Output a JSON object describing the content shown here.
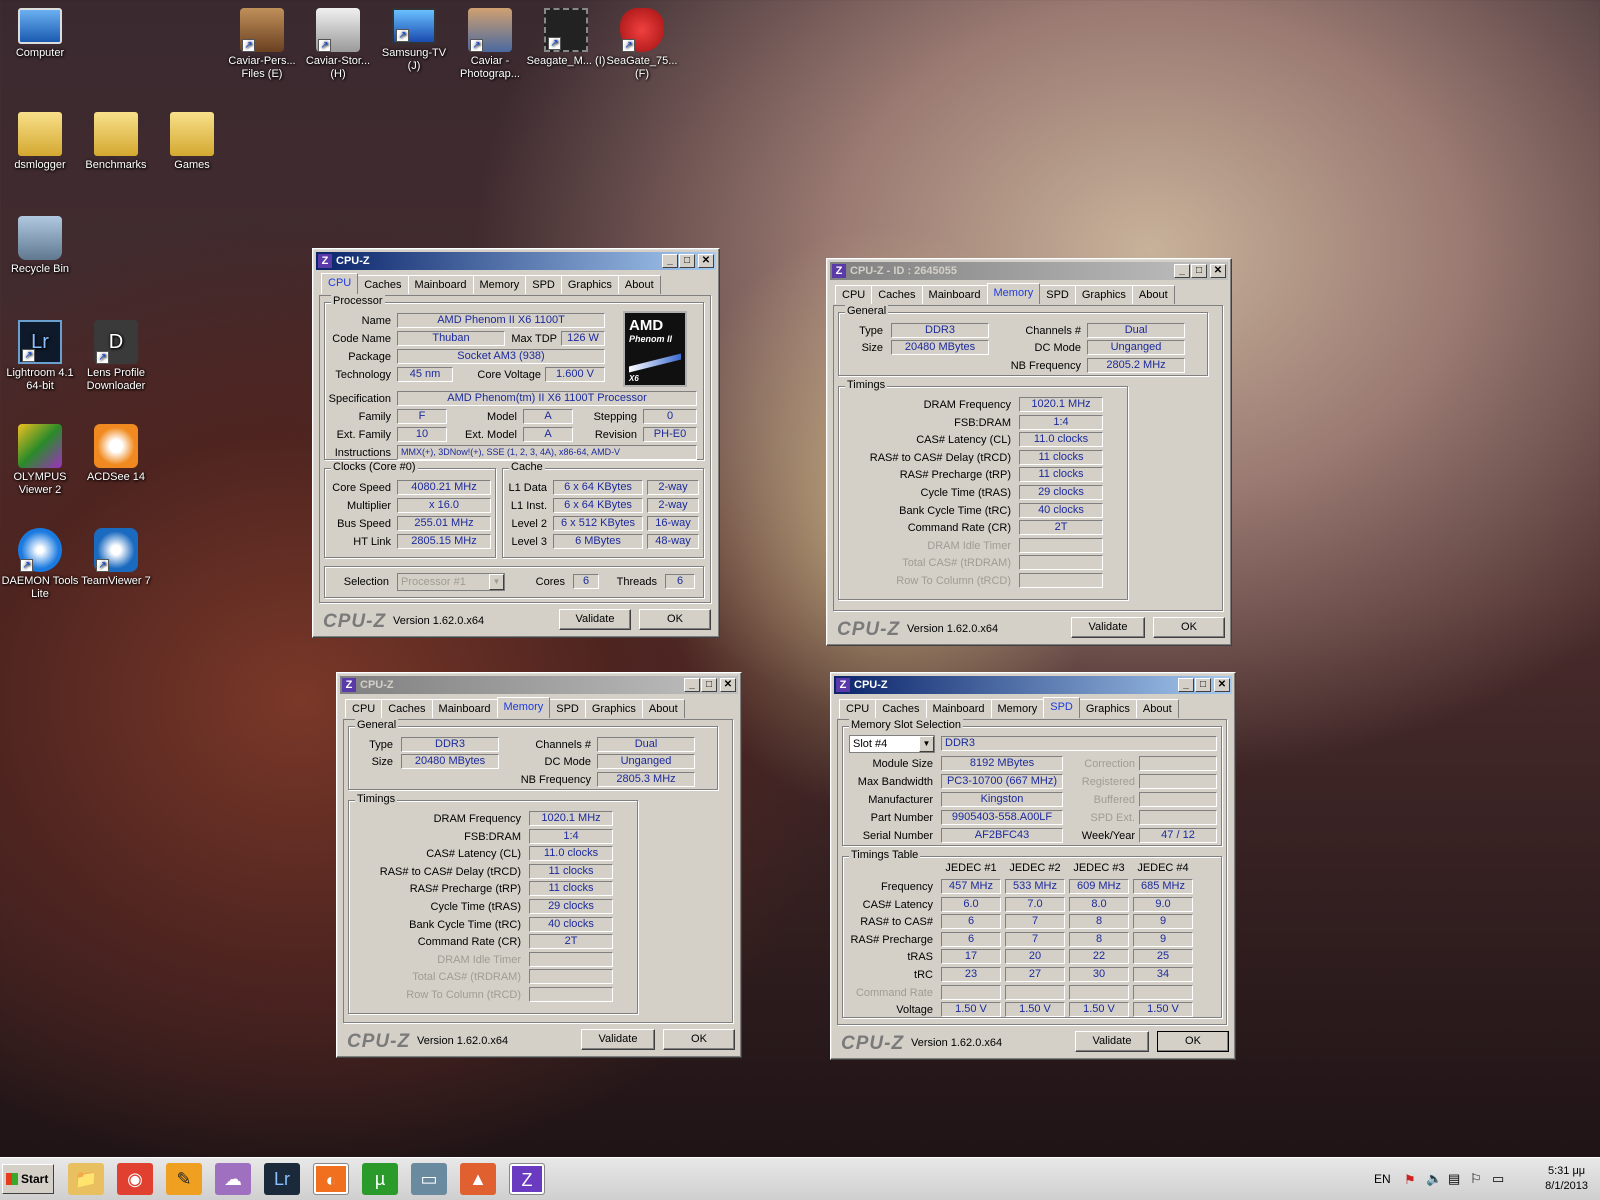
{
  "desktop": {
    "icons": [
      {
        "label": "Computer"
      },
      {
        "label": "Caviar-Pers... Files (E)"
      },
      {
        "label": "Caviar-Stor... (H)"
      },
      {
        "label": "Samsung-TV (J)"
      },
      {
        "label": "Caviar - Photograp..."
      },
      {
        "label": "Seagate_M... (I)"
      },
      {
        "label": "SeaGate_75... (F)"
      },
      {
        "label": "dsmlogger"
      },
      {
        "label": "Benchmarks"
      },
      {
        "label": "Games"
      },
      {
        "label": "Recycle Bin"
      },
      {
        "label": "Lightroom 4.1 64-bit"
      },
      {
        "label": "Lens Profile Downloader"
      },
      {
        "label": "OLYMPUS Viewer 2"
      },
      {
        "label": "ACDSee 14"
      },
      {
        "label": "DAEMON Tools Lite"
      },
      {
        "label": "TeamViewer 7"
      }
    ]
  },
  "common": {
    "tabs": [
      "CPU",
      "Caches",
      "Mainboard",
      "Memory",
      "SPD",
      "Graphics",
      "About"
    ],
    "brand": "CPU-Z",
    "version": "Version 1.62.0.x64",
    "validate": "Validate",
    "ok": "OK",
    "minimize": "_",
    "maximize": "□",
    "close": "✕",
    "z": "Z"
  },
  "cpu_window": {
    "title": "CPU-Z",
    "processor_group": "Processor",
    "name_label": "Name",
    "name": "AMD Phenom II X6 1100T",
    "codename_label": "Code Name",
    "codename": "Thuban",
    "maxtdp_label": "Max TDP",
    "maxtdp": "126 W",
    "package_label": "Package",
    "package": "Socket AM3 (938)",
    "technology_label": "Technology",
    "technology": "45 nm",
    "corevoltage_label": "Core Voltage",
    "corevoltage": "1.600 V",
    "spec_label": "Specification",
    "spec": "AMD Phenom(tm) II X6 1100T Processor",
    "family_label": "Family",
    "family": "F",
    "model_label": "Model",
    "model": "A",
    "stepping_label": "Stepping",
    "stepping": "0",
    "extfamily_label": "Ext. Family",
    "extfamily": "10",
    "extmodel_label": "Ext. Model",
    "extmodel": "A",
    "revision_label": "Revision",
    "revision": "PH-E0",
    "instructions_label": "Instructions",
    "instructions": "MMX(+), 3DNow!(+), SSE (1, 2, 3, 4A), x86-64, AMD-V",
    "logo_line1": "AMD",
    "logo_line2": "Phenom II",
    "logo_line3": "X6",
    "clocks_group": "Clocks (Core #0)",
    "corespeed_label": "Core Speed",
    "corespeed": "4080.21 MHz",
    "multiplier_label": "Multiplier",
    "multiplier": "x 16.0",
    "busspeed_label": "Bus Speed",
    "busspeed": "255.01 MHz",
    "htlink_label": "HT Link",
    "htlink": "2805.15 MHz",
    "cache_group": "Cache",
    "l1data_label": "L1 Data",
    "l1data": "6 x 64 KBytes",
    "l1data_way": "2-way",
    "l1inst_label": "L1 Inst.",
    "l1inst": "6 x 64 KBytes",
    "l1inst_way": "2-way",
    "l2_label": "Level 2",
    "l2": "6 x 512 KBytes",
    "l2_way": "16-way",
    "l3_label": "Level 3",
    "l3": "6 MBytes",
    "l3_way": "48-way",
    "selection_label": "Selection",
    "selection": "Processor #1",
    "cores_label": "Cores",
    "cores": "6",
    "threads_label": "Threads",
    "threads": "6"
  },
  "mem_window_1": {
    "title": "CPU-Z - ID : 2645055",
    "general_group": "General",
    "type_label": "Type",
    "type": "DDR3",
    "size_label": "Size",
    "size": "20480 MBytes",
    "channels_label": "Channels #",
    "channels": "Dual",
    "dcmode_label": "DC Mode",
    "dcmode": "Unganged",
    "nbfreq_label": "NB Frequency",
    "nbfreq": "2805.2 MHz",
    "timings_group": "Timings",
    "rows": [
      {
        "label": "DRAM Frequency",
        "value": "1020.1 MHz",
        "dis": false
      },
      {
        "label": "FSB:DRAM",
        "value": "1:4",
        "dis": false
      },
      {
        "label": "CAS# Latency (CL)",
        "value": "11.0 clocks",
        "dis": false
      },
      {
        "label": "RAS# to CAS# Delay (tRCD)",
        "value": "11 clocks",
        "dis": false
      },
      {
        "label": "RAS# Precharge (tRP)",
        "value": "11 clocks",
        "dis": false
      },
      {
        "label": "Cycle Time (tRAS)",
        "value": "29 clocks",
        "dis": false
      },
      {
        "label": "Bank Cycle Time (tRC)",
        "value": "40 clocks",
        "dis": false
      },
      {
        "label": "Command Rate (CR)",
        "value": "2T",
        "dis": false
      },
      {
        "label": "DRAM Idle Timer",
        "value": "",
        "dis": true
      },
      {
        "label": "Total CAS# (tRDRAM)",
        "value": "",
        "dis": true
      },
      {
        "label": "Row To Column (tRCD)",
        "value": "",
        "dis": true
      }
    ]
  },
  "mem_window_2": {
    "title": "CPU-Z",
    "general_group": "General",
    "type_label": "Type",
    "type": "DDR3",
    "size_label": "Size",
    "size": "20480 MBytes",
    "channels_label": "Channels #",
    "channels": "Dual",
    "dcmode_label": "DC Mode",
    "dcmode": "Unganged",
    "nbfreq_label": "NB Frequency",
    "nbfreq": "2805.3 MHz",
    "timings_group": "Timings",
    "rows": [
      {
        "label": "DRAM Frequency",
        "value": "1020.1 MHz",
        "dis": false
      },
      {
        "label": "FSB:DRAM",
        "value": "1:4",
        "dis": false
      },
      {
        "label": "CAS# Latency (CL)",
        "value": "11.0 clocks",
        "dis": false
      },
      {
        "label": "RAS# to CAS# Delay (tRCD)",
        "value": "11 clocks",
        "dis": false
      },
      {
        "label": "RAS# Precharge (tRP)",
        "value": "11 clocks",
        "dis": false
      },
      {
        "label": "Cycle Time (tRAS)",
        "value": "29 clocks",
        "dis": false
      },
      {
        "label": "Bank Cycle Time (tRC)",
        "value": "40 clocks",
        "dis": false
      },
      {
        "label": "Command Rate (CR)",
        "value": "2T",
        "dis": false
      },
      {
        "label": "DRAM Idle Timer",
        "value": "",
        "dis": true
      },
      {
        "label": "Total CAS# (tRDRAM)",
        "value": "",
        "dis": true
      },
      {
        "label": "Row To Column (tRCD)",
        "value": "",
        "dis": true
      }
    ]
  },
  "spd_window": {
    "title": "CPU-Z",
    "slot_group": "Memory Slot Selection",
    "slot": "Slot #4",
    "slot_type": "DDR3",
    "modulesize_label": "Module Size",
    "modulesize": "8192 MBytes",
    "maxbw_label": "Max Bandwidth",
    "maxbw": "PC3-10700 (667 MHz)",
    "manufacturer_label": "Manufacturer",
    "manufacturer": "Kingston",
    "partnumber_label": "Part Number",
    "partnumber": "9905403-558.A00LF",
    "serial_label": "Serial Number",
    "serial": "AF2BFC43",
    "correction_label": "Correction",
    "registered_label": "Registered",
    "buffered_label": "Buffered",
    "spdext_label": "SPD Ext.",
    "weekyear_label": "Week/Year",
    "weekyear": "47 / 12",
    "timings_group": "Timings Table",
    "jedec_headers": [
      "JEDEC #1",
      "JEDEC #2",
      "JEDEC #3",
      "JEDEC #4"
    ],
    "rows": [
      {
        "label": "Frequency",
        "values": [
          "457 MHz",
          "533 MHz",
          "609 MHz",
          "685 MHz"
        ],
        "dis": false
      },
      {
        "label": "CAS# Latency",
        "values": [
          "6.0",
          "7.0",
          "8.0",
          "9.0"
        ],
        "dis": false
      },
      {
        "label": "RAS# to CAS#",
        "values": [
          "6",
          "7",
          "8",
          "9"
        ],
        "dis": false
      },
      {
        "label": "RAS# Precharge",
        "values": [
          "6",
          "7",
          "8",
          "9"
        ],
        "dis": false
      },
      {
        "label": "tRAS",
        "values": [
          "17",
          "20",
          "22",
          "25"
        ],
        "dis": false
      },
      {
        "label": "tRC",
        "values": [
          "23",
          "27",
          "30",
          "34"
        ],
        "dis": false
      },
      {
        "label": "Command Rate",
        "values": [
          "",
          "",
          "",
          ""
        ],
        "dis": true
      },
      {
        "label": "Voltage",
        "values": [
          "1.50 V",
          "1.50 V",
          "1.50 V",
          "1.50 V"
        ],
        "dis": false
      }
    ]
  },
  "taskbar": {
    "start": "Start",
    "lang": "EN",
    "time": "5:31 μμ",
    "date": "8/1/2013",
    "apps": [
      "explorer-icon",
      "chrome-icon",
      "pen-icon",
      "chat-icon",
      "lightroom-icon",
      "firefox-icon",
      "utorrent-icon",
      "wintv-icon",
      "fire-icon",
      "cpuz-icon"
    ],
    "app_labels": [
      "📁",
      "◉",
      "✎",
      "☁",
      "Lr",
      "◐",
      "µ",
      "▭",
      "▲",
      "Z"
    ]
  }
}
